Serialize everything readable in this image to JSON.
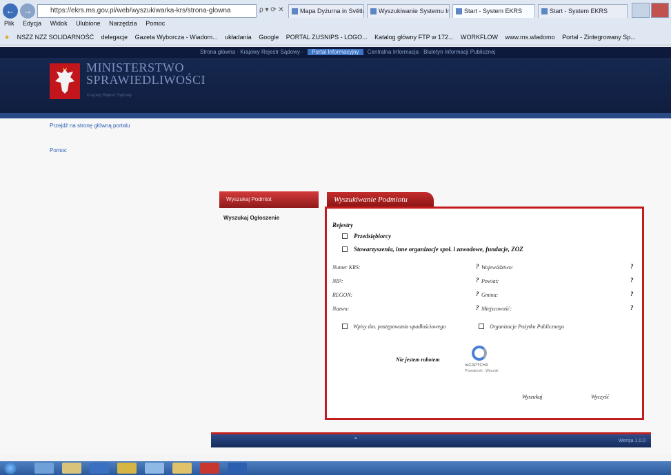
{
  "browser": {
    "url": "https://ekrs.ms.gov.pl/web/wyszukiwarka-krs/strona-glowna",
    "tabs": [
      "Mapa Dyżurna in Světlana",
      "Wyszukiwanie Systemu Informacji",
      "Start - System EKRS",
      "Start - System EKRS"
    ],
    "menu": [
      "Plik",
      "Edycja",
      "Widok",
      "Ulubione",
      "Narzędzia",
      "Pomoc"
    ],
    "favorites": [
      "NSZZ NZZ SOLIDARNOŚĆ",
      "delegacje",
      "Gazeta Wyborcza - Wiadom...",
      "układania",
      "Google",
      "PORTAL ZUSNIPS - LOGO...",
      "Katalog główny FTP w 172...",
      "WORKFLOW",
      "www.ms.wladomo",
      "Portal - Zintegrowany Sp..."
    ]
  },
  "portal": {
    "top_strip_items": [
      "Strona główna",
      "Krajowy Rejestr Sądowy",
      "Centralna Informacja",
      "Biuletyn Informacji Publicznej"
    ],
    "top_strip_active": "Portal Informacyjny",
    "brand_line1": "MINISTERSTWO",
    "brand_line2": "SPRAWIEDLIWOŚCI",
    "banner_sub": "Krajowy Rejestr Sądowy"
  },
  "left_nav": {
    "home_link": "Przejdź na stronę główną portalu",
    "help_link": "Pomoc"
  },
  "side_menu": {
    "active": "Wyszukaj Podmiot",
    "items": [
      "Wyszukaj Ogłoszenie"
    ]
  },
  "form": {
    "title": "Wyszukiwanie Podmiotu",
    "registers_label": "Rejestry",
    "reg_entrepreneurs": "Przedsiębiorcy",
    "reg_associations": "Stowarzyszenia, inne organizacje społ. i zawodowe, fundacje, ZOZ",
    "label_krs": "Numer KRS:",
    "label_nip": "NIP:",
    "label_regon": "REGON:",
    "label_name": "Nazwa:",
    "label_voivodeship": "Województwo:",
    "label_county": "Powiat:",
    "label_commune": "Gmina:",
    "label_city": "Miejscowość:",
    "hint": "?",
    "cb_insolvency": "Wpisy dot. postępowania upadłościowego",
    "cb_opp": "Organizacje Pożytku Publicznego",
    "captcha_label": "Nie jestem robotem",
    "captcha_brand": "reCAPTCHA",
    "captcha_terms": "Prywatność - Warunki",
    "btn_search": "Wyszukaj",
    "btn_clear": "Wyczyść"
  },
  "footer": {
    "chevron": "⌃",
    "text": "Wersja 1.0.0"
  },
  "colors": {
    "navy": "#16284f",
    "accent_red": "#c21d1d",
    "link_blue": "#2c5db2"
  }
}
